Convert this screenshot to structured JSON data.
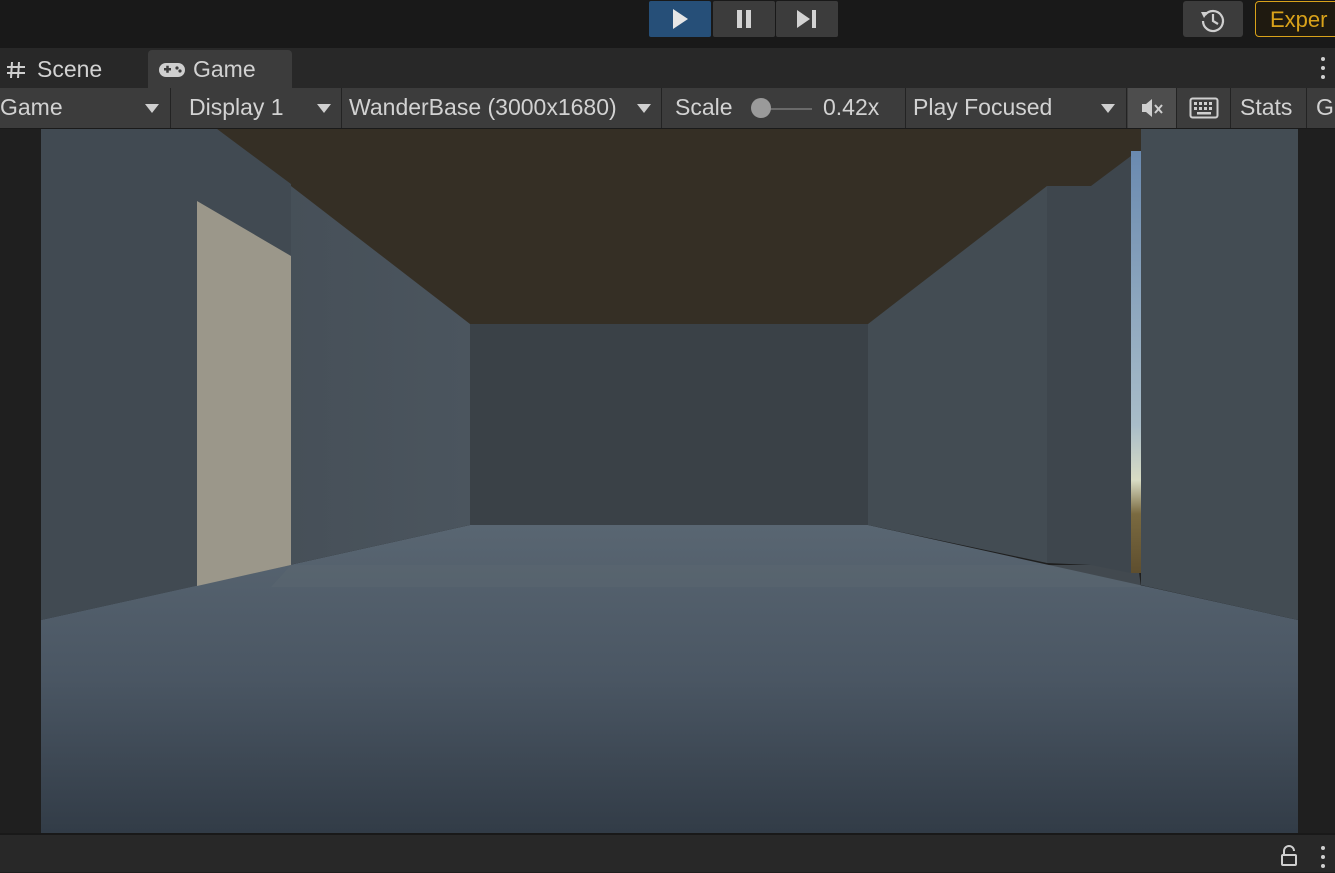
{
  "toolbar_top": {
    "play_icon": "play-icon",
    "pause_icon": "pause-icon",
    "step_icon": "step-icon",
    "history_icon": "history-icon",
    "experience_label": "Exper",
    "play_active": true,
    "accent_color": "#264f78",
    "experience_color": "#d9a21a"
  },
  "tabs": [
    {
      "label": "Scene",
      "icon": "grid-icon",
      "active": false
    },
    {
      "label": "Game",
      "icon": "gamepad-icon",
      "active": true
    }
  ],
  "game_toolbar": {
    "view_mode": "Game",
    "display": "Display 1",
    "resolution": "WanderBase (3000x1680)",
    "scale_label": "Scale",
    "scale_value": "0.42x",
    "scale": 0.42,
    "play_mode": "Play Focused",
    "mute_icon": "audio-mute-icon",
    "keyboard_icon": "keyboard-icon",
    "stats_label": "Stats",
    "gizmos_label": "Gizmos"
  },
  "status_bar": {
    "lock_icon": "lock-icon",
    "menu_icon": "kebab-menu-icon"
  }
}
